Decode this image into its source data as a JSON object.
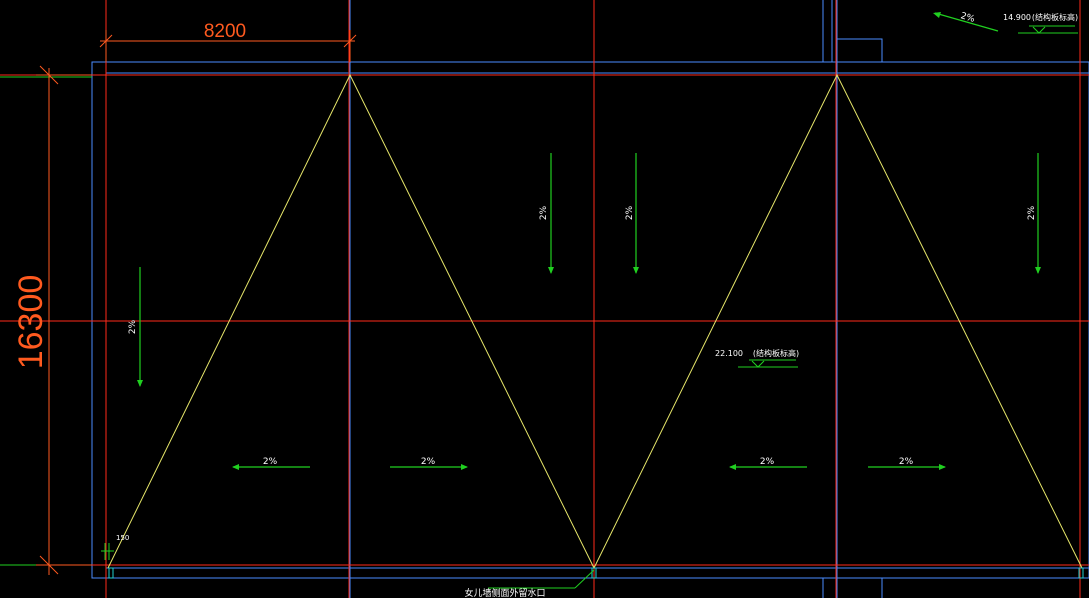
{
  "colors": {
    "background": "#000000",
    "axis_red": "#ff2a1a",
    "wall_blue": "#4a8cff",
    "ridge_yellow": "#e6e66a",
    "slope_green": "#20d020",
    "text_white": "#ffffff",
    "dim_orange": "#ff5a1f"
  },
  "dimensions": {
    "top_span": "8200",
    "left_span": "16300"
  },
  "slopes": {
    "vertical_1": "2%",
    "vertical_2": "2%",
    "vertical_3": "2%",
    "vertical_4": "2%",
    "horizontal_1": "2%",
    "horizontal_2": "2%",
    "horizontal_3": "2%",
    "horizontal_4": "2%",
    "top_right": "2%"
  },
  "elevations": {
    "top_right_value": "14.900",
    "top_right_note": "(结构板标高)",
    "center_value": "22.100",
    "center_note": "(结构板标高)"
  },
  "labels": {
    "small_dim": "150",
    "drain_note": "女儿墙侧面外留水口"
  }
}
